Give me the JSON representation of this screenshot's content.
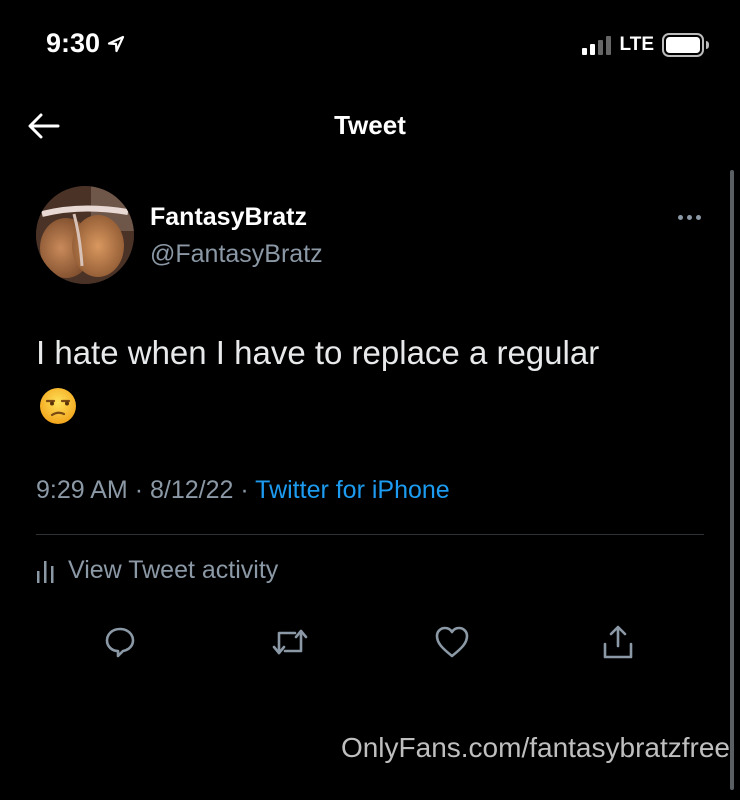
{
  "status_bar": {
    "time": "9:30",
    "network": "LTE",
    "icons": [
      "location-arrow-icon",
      "signal-icon",
      "battery-icon"
    ]
  },
  "header": {
    "title": "Tweet",
    "back_icon": "arrow-left-icon"
  },
  "tweet": {
    "author_name": "FantasyBratz",
    "author_handle": "@FantasyBratz",
    "text": "I hate when I have to replace a regular",
    "emoji": "unamused-face-icon",
    "time": "9:29 AM",
    "separator": "·",
    "date": "8/12/22",
    "source": "Twitter for iPhone",
    "activity_label": "View Tweet activity",
    "actions": [
      "reply-icon",
      "retweet-icon",
      "like-icon",
      "share-icon"
    ]
  },
  "watermark": "OnlyFans.com/fantasybratzfree",
  "colors": {
    "background": "#000000",
    "link": "#1d9bf0",
    "secondary_text": "#8b98a5",
    "primary_text": "#e7e9ea"
  }
}
